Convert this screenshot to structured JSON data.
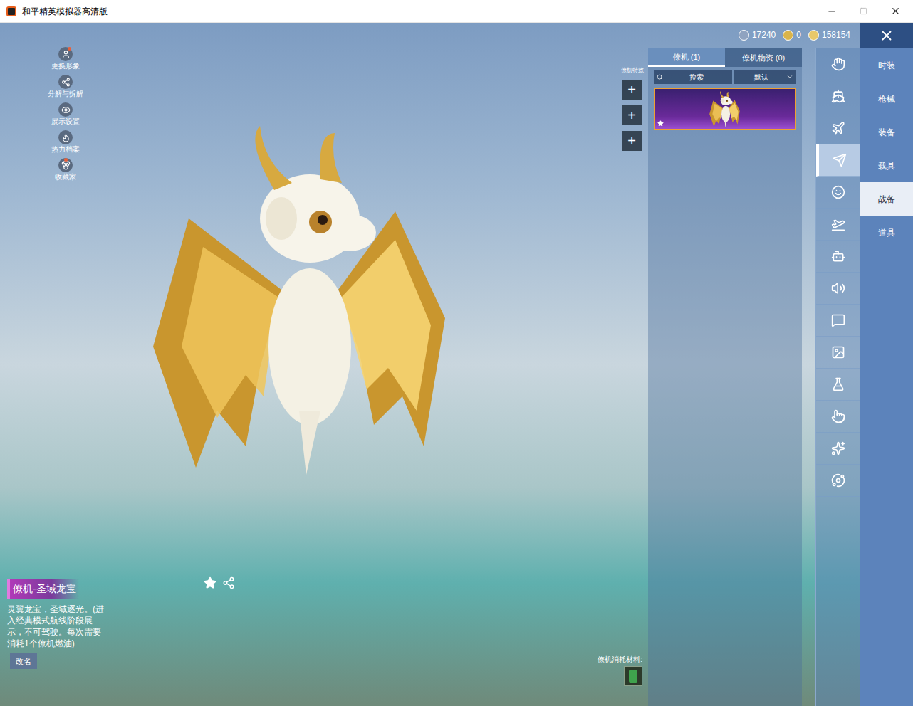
{
  "window": {
    "title": "和平精英模拟器高清版"
  },
  "left_menu": [
    {
      "label": "更换形象",
      "badge": true
    },
    {
      "label": "分解与拆解",
      "badge": false
    },
    {
      "label": "展示设置",
      "badge": false
    },
    {
      "label": "热力档案",
      "badge": false
    },
    {
      "label": "收藏家",
      "badge": true
    }
  ],
  "currencies": [
    {
      "value": "17240"
    },
    {
      "value": "0"
    },
    {
      "value": "158154"
    }
  ],
  "effects": {
    "label": "僚机特效",
    "buttons": [
      "+",
      "+",
      "+"
    ]
  },
  "panel": {
    "tabs": [
      {
        "label": "僚机 (1)",
        "selected": true
      },
      {
        "label": "僚机物资 (0)",
        "selected": false
      }
    ],
    "search": {
      "placeholder": "搜索"
    },
    "sort": "默认",
    "items": [
      {
        "selected": true,
        "favorite": true
      }
    ]
  },
  "icon_nav": [
    {
      "selected": false
    },
    {
      "selected": false
    },
    {
      "selected": false
    },
    {
      "selected": true
    },
    {
      "selected": false
    },
    {
      "selected": false
    },
    {
      "selected": false
    },
    {
      "selected": false
    },
    {
      "selected": false
    },
    {
      "selected": false
    },
    {
      "selected": false
    },
    {
      "selected": false
    },
    {
      "selected": false
    },
    {
      "selected": false
    }
  ],
  "categories": [
    {
      "label": "时装",
      "selected": false
    },
    {
      "label": "枪械",
      "selected": false
    },
    {
      "label": "装备",
      "selected": false
    },
    {
      "label": "载具",
      "selected": false
    },
    {
      "label": "战备",
      "selected": true
    },
    {
      "label": "道具",
      "selected": false
    }
  ],
  "item_info": {
    "name": "僚机-圣域龙宝",
    "description": "灵翼龙宝，圣域逐光。(进入经典模式航线阶段展示，不可驾驶。每次需要消耗1个僚机燃油)",
    "rename": "改名"
  },
  "materials": {
    "label": "僚机消耗材料:"
  }
}
